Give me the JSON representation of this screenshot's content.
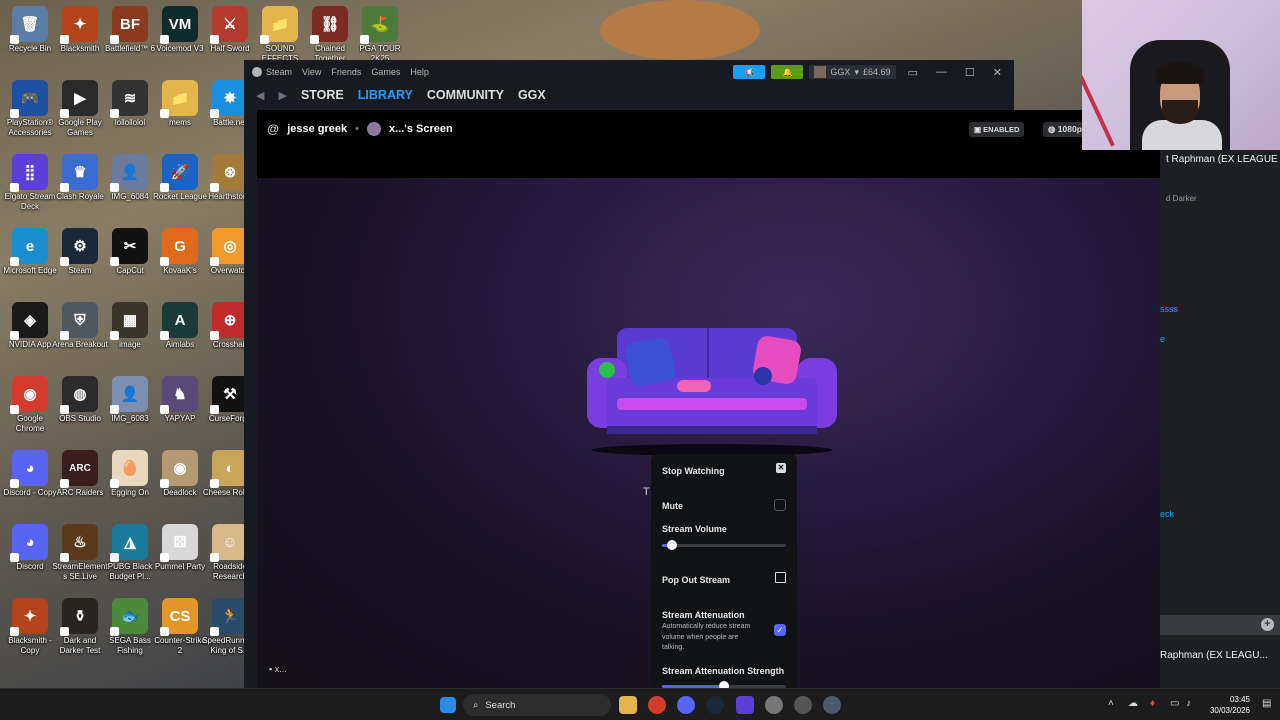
{
  "desktop": {
    "icons": [
      {
        "label": "Recycle Bin",
        "col": 0,
        "row": 0,
        "color": "#5b7ea6",
        "glyph": "🗑"
      },
      {
        "label": "Blacksmith",
        "col": 1,
        "row": 0,
        "color": "#b4441c",
        "glyph": "✦"
      },
      {
        "label": "Battlefield™ 6",
        "col": 2,
        "row": 0,
        "color": "#8a3a1f",
        "glyph": "BF"
      },
      {
        "label": "Voicemod V3",
        "col": 3,
        "row": 0,
        "color": "#0f2b2b",
        "glyph": "VM"
      },
      {
        "label": "Half Sword",
        "col": 4,
        "row": 0,
        "color": "#b23a2e",
        "glyph": "⚔"
      },
      {
        "label": "SOUND EFFECTS",
        "col": 5,
        "row": 0,
        "color": "#e3b64b",
        "glyph": "📁"
      },
      {
        "label": "Chained Together",
        "col": 6,
        "row": 0,
        "color": "#7b2b22",
        "glyph": "⛓"
      },
      {
        "label": "PGA TOUR 2K25",
        "col": 7,
        "row": 0,
        "color": "#4c7a3a",
        "glyph": "⛳"
      },
      {
        "label": "PlayStation® Accessories",
        "col": 0,
        "row": 1,
        "color": "#1d4fa3",
        "glyph": "🎮"
      },
      {
        "label": "Google Play Games",
        "col": 1,
        "row": 1,
        "color": "#2a2a2a",
        "glyph": "▶"
      },
      {
        "label": "lollollolol",
        "col": 2,
        "row": 1,
        "color": "#333",
        "glyph": "≋"
      },
      {
        "label": "mems",
        "col": 3,
        "row": 1,
        "color": "#e3b64b",
        "glyph": "📁"
      },
      {
        "label": "Battle.net",
        "col": 4,
        "row": 1,
        "color": "#1a8fe0",
        "glyph": "✸"
      },
      {
        "label": "Elgato Stream Deck",
        "col": 0,
        "row": 2,
        "color": "#5b3fd6",
        "glyph": "⣿"
      },
      {
        "label": "Clash Royale",
        "col": 1,
        "row": 2,
        "color": "#3c6bd1",
        "glyph": "♛"
      },
      {
        "label": "IMG_6084",
        "col": 2,
        "row": 2,
        "color": "#6a7b9c",
        "glyph": "👤"
      },
      {
        "label": "Rocket League",
        "col": 3,
        "row": 2,
        "color": "#1b64c4",
        "glyph": "🚀"
      },
      {
        "label": "Hearthstone",
        "col": 4,
        "row": 2,
        "color": "#a37a3a",
        "glyph": "⊛"
      },
      {
        "label": "Microsoft Edge",
        "col": 0,
        "row": 3,
        "color": "#1a8fd0",
        "glyph": "e"
      },
      {
        "label": "Steam",
        "col": 1,
        "row": 3,
        "color": "#1b2838",
        "glyph": "⚙"
      },
      {
        "label": "CapCut",
        "col": 2,
        "row": 3,
        "color": "#111",
        "glyph": "✂"
      },
      {
        "label": "KovaaK's",
        "col": 3,
        "row": 3,
        "color": "#e06a1a",
        "glyph": "G"
      },
      {
        "label": "Overwatch",
        "col": 4,
        "row": 3,
        "color": "#f19a2b",
        "glyph": "◎"
      },
      {
        "label": "NVIDIA App",
        "col": 0,
        "row": 4,
        "color": "#1a1a1a",
        "glyph": "◈"
      },
      {
        "label": "Arena Breakout",
        "col": 1,
        "row": 4,
        "color": "#4d5860",
        "glyph": "⛨"
      },
      {
        "label": "image",
        "col": 2,
        "row": 4,
        "color": "#3b3428",
        "glyph": "▦"
      },
      {
        "label": "Aimlabs",
        "col": 3,
        "row": 4,
        "color": "#1b3a3a",
        "glyph": "A"
      },
      {
        "label": "Crosshair",
        "col": 4,
        "row": 4,
        "color": "#c02a2a",
        "glyph": "⊕"
      },
      {
        "label": "Google Chrome",
        "col": 0,
        "row": 5,
        "color": "#d33b2f",
        "glyph": "◉"
      },
      {
        "label": "OBS Studio",
        "col": 1,
        "row": 5,
        "color": "#2b2b2b",
        "glyph": "◍"
      },
      {
        "label": "IMG_6083",
        "col": 2,
        "row": 5,
        "color": "#7c8fb0",
        "glyph": "👤"
      },
      {
        "label": "YAPYAP",
        "col": 3,
        "row": 5,
        "color": "#5a4a7a",
        "glyph": "♞"
      },
      {
        "label": "CurseForge",
        "col": 4,
        "row": 5,
        "color": "#111",
        "glyph": "⚒"
      },
      {
        "label": "Discord - Copy",
        "col": 0,
        "row": 6,
        "color": "#5865f2",
        "glyph": "◕"
      },
      {
        "label": "ARC Raiders",
        "col": 1,
        "row": 6,
        "color": "#3a1e1e",
        "glyph": "ARC"
      },
      {
        "label": "Egging On",
        "col": 2,
        "row": 6,
        "color": "#e8d8c0",
        "glyph": "🥚"
      },
      {
        "label": "Deadlock",
        "col": 3,
        "row": 6,
        "color": "#b49a72",
        "glyph": "◉"
      },
      {
        "label": "Cheese Rolling",
        "col": 4,
        "row": 6,
        "color": "#c9a55a",
        "glyph": "◐"
      },
      {
        "label": "Discord",
        "col": 0,
        "row": 7,
        "color": "#5865f2",
        "glyph": "◕"
      },
      {
        "label": "StreamElements SE.Live",
        "col": 1,
        "row": 7,
        "color": "#5a3a1a",
        "glyph": "♨"
      },
      {
        "label": "PUBG Black Budget Pl...",
        "col": 2,
        "row": 7,
        "color": "#1a7a9a",
        "glyph": "◮"
      },
      {
        "label": "Pummel Party",
        "col": 3,
        "row": 7,
        "color": "#d8d8d8",
        "glyph": "⚄"
      },
      {
        "label": "Roadside Research",
        "col": 4,
        "row": 7,
        "color": "#d7b98a",
        "glyph": "☺"
      },
      {
        "label": "Blacksmith - Copy",
        "col": 0,
        "row": 8,
        "color": "#b4441c",
        "glyph": "✦"
      },
      {
        "label": "Dark and Darker Test",
        "col": 1,
        "row": 8,
        "color": "#2a2420",
        "glyph": "⚱"
      },
      {
        "label": "SEGA Bass Fishing",
        "col": 2,
        "row": 8,
        "color": "#4a8a3a",
        "glyph": "🐟"
      },
      {
        "label": "Counter-Strike 2",
        "col": 3,
        "row": 8,
        "color": "#e2962a",
        "glyph": "CS"
      },
      {
        "label": "SpeedRunn... 2 King of S...",
        "col": 4,
        "row": 8,
        "color": "#2a4a6a",
        "glyph": "🏃"
      }
    ]
  },
  "steam": {
    "menu": [
      "Steam",
      "View",
      "Friends",
      "Games",
      "Help"
    ],
    "nav": [
      "STORE",
      "LIBRARY",
      "COMMUNITY",
      "GGX"
    ],
    "account_name": "GGX",
    "balance": "£64.69"
  },
  "stream": {
    "at_symbol": "@",
    "username": "jesse greek",
    "screen_title": "x...'s Screen",
    "enabled_badge": "ENABLED",
    "resolution_badge": "1080p",
    "footer_label": "x...",
    "partial_letter": "T"
  },
  "popup": {
    "stop_watching": "Stop Watching",
    "mute": "Mute",
    "mute_checked": false,
    "stream_volume": "Stream Volume",
    "volume_level": 0.08,
    "pop_out": "Pop Out Stream",
    "attenuation": "Stream Attenuation",
    "attenuation_desc": "Automatically reduce stream volume when people are talking.",
    "attenuation_checked": true,
    "attenuation_strength": "Stream Attenuation Strength",
    "attenuation_strength_level": 0.5
  },
  "right_pane": {
    "name_top": "t Raphman (EX LEAGUE",
    "sub_top": "d Darker",
    "link_1": "ssss",
    "link_2": "e",
    "link_3": "eck",
    "name_bottom": "Raphman (EX LEAGU..."
  },
  "taskbar": {
    "search_label": "Search",
    "time": "03:45",
    "date": "30/03/2026"
  },
  "colors": {
    "accent_blue": "#1a9fff",
    "discord_blurple": "#5865f2"
  }
}
